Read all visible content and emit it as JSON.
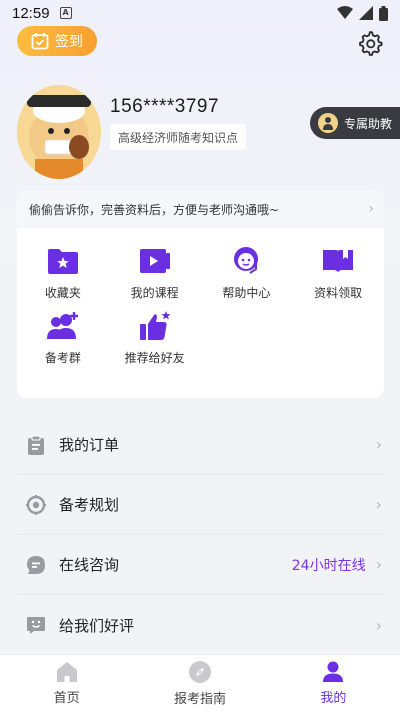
{
  "status_bar": {
    "time": "12:59",
    "notification_glyph": "A"
  },
  "header": {
    "signin_label": "签到",
    "settings_icon": "gear-icon"
  },
  "profile": {
    "username": "156****3797",
    "tag": "高级经济师随考知识点",
    "assistant_label": "专属助教"
  },
  "card": {
    "tip": "偷偷告诉你，完善资料后，方便与老师沟通哦~",
    "items": [
      {
        "label": "收藏夹",
        "icon": "folder-star-icon"
      },
      {
        "label": "我的课程",
        "icon": "video-course-icon"
      },
      {
        "label": "帮助中心",
        "icon": "headset-icon"
      },
      {
        "label": "资料领取",
        "icon": "book-icon"
      },
      {
        "label": "备考群",
        "icon": "group-add-icon"
      },
      {
        "label": "推荐给好友",
        "icon": "thumbs-up-star-icon"
      }
    ]
  },
  "menu": [
    {
      "label": "我的订单",
      "icon": "clipboard-icon",
      "extra": ""
    },
    {
      "label": "备考规划",
      "icon": "target-icon",
      "extra": ""
    },
    {
      "label": "在线咨询",
      "icon": "chat-icon",
      "extra": "24小时在线"
    },
    {
      "label": "给我们好评",
      "icon": "smile-message-icon",
      "extra": ""
    }
  ],
  "tabs": [
    {
      "label": "首页",
      "icon": "home-icon",
      "active": false
    },
    {
      "label": "报考指南",
      "icon": "compass-icon",
      "active": false
    },
    {
      "label": "我的",
      "icon": "user-icon",
      "active": true
    }
  ],
  "colors": {
    "accent": "#6a2fe0",
    "signin": "#f7a030"
  }
}
